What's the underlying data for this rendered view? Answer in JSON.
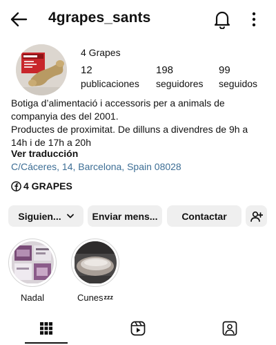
{
  "header": {
    "username": "4grapes_sants",
    "back_icon": "arrow-left-icon",
    "notifications_icon": "bell-icon",
    "more_icon": "more-vertical-icon"
  },
  "profile": {
    "avatar_icon": "profile-photo",
    "display_name": "4 Grapes",
    "stats": [
      {
        "value": "12",
        "label": "publicaciones"
      },
      {
        "value": "198",
        "label": "seguidores"
      },
      {
        "value": "99",
        "label": "seguidos"
      }
    ],
    "bio_lines": [
      "Botiga d’alimentació i accessoris per a animals de",
      "companyia des del 2001.",
      "Productes de proximitat. De dilluns a divendres de 9h a",
      "14h i de 17h a 20h"
    ],
    "see_translation": "Ver traducción",
    "address": "C/Cáceres, 14, Barcelona, Spain 08028",
    "facebook_label": "4 GRAPES",
    "facebook_icon": "facebook-icon"
  },
  "actions": {
    "following_label": "Siguien...",
    "message_label": "Enviar mens...",
    "contact_label": "Contactar",
    "add_person_icon": "person-add-icon"
  },
  "highlights": [
    {
      "label": "Nadal",
      "suffix": ""
    },
    {
      "label": "Cunes",
      "suffix": "zzz"
    }
  ],
  "tabs": [
    {
      "icon": "grid-icon",
      "active": true
    },
    {
      "icon": "reels-icon",
      "active": false
    },
    {
      "icon": "tagged-icon",
      "active": false
    }
  ],
  "colors": {
    "link": "#3d6e95",
    "button_bg": "#efefef",
    "text": "#111111"
  }
}
